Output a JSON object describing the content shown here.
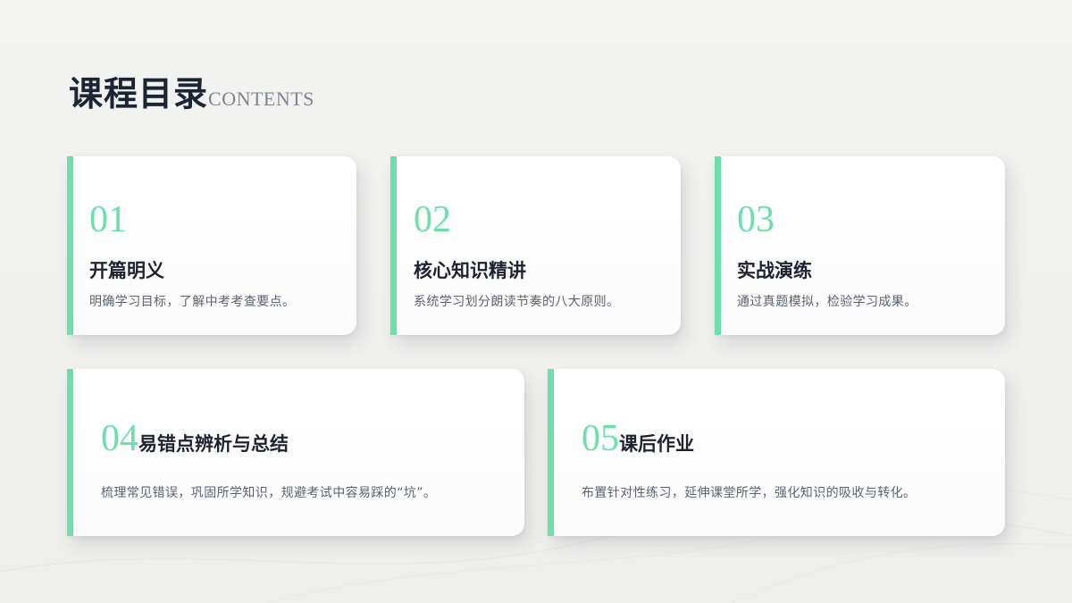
{
  "header": {
    "title": "课程目录",
    "subtitle": "CONTENTS"
  },
  "colors": {
    "accent": "#6cdfab",
    "title": "#1d2535",
    "text": "#5c6370"
  },
  "cards": [
    {
      "number": "01",
      "heading": "开篇明义",
      "description": "明确学习目标，了解中考考查要点。"
    },
    {
      "number": "02",
      "heading": "核心知识精讲",
      "description": "系统学习划分朗读节奏的八大原则。"
    },
    {
      "number": "03",
      "heading": "实战演练",
      "description": "通过真题模拟，检验学习成果。"
    },
    {
      "number": "04",
      "heading": "易错点辨析与总结",
      "description": "梳理常见错误，巩固所学知识，规避考试中容易踩的“坑”。"
    },
    {
      "number": "05",
      "heading": "课后作业",
      "description": "布置针对性练习，延伸课堂所学，强化知识的吸收与转化。"
    }
  ]
}
